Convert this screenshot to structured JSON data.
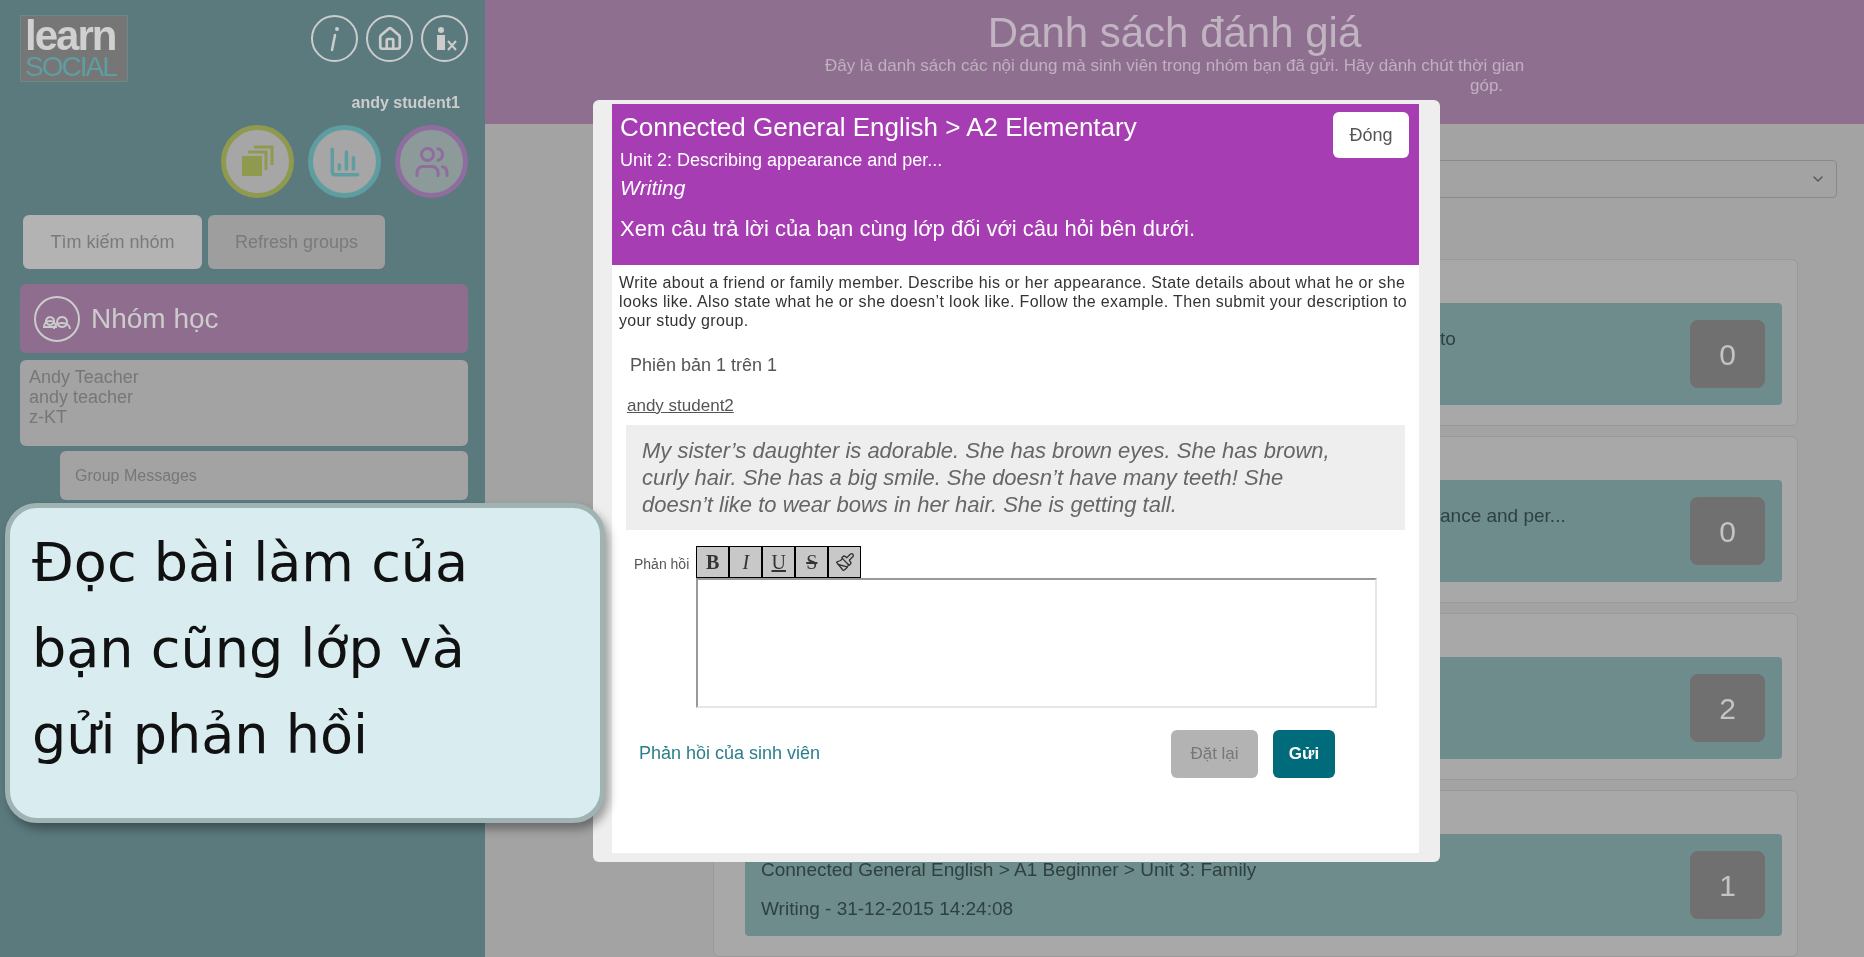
{
  "sidebar": {
    "logo": {
      "line_1": "learn",
      "line_2": "SOCIAL"
    },
    "username": "andy student1",
    "buttons": [
      {
        "label": "Tìm kiếm nhóm",
        "kind": "light"
      },
      {
        "label": "Refresh groups",
        "kind": "dark"
      }
    ],
    "section_title": "Nhóm học",
    "group_lines": [
      "Andy Teacher",
      "andy teacher",
      "z-KT"
    ],
    "group_messages": "Group Messages"
  },
  "header": {
    "title": "Danh sách đánh giá",
    "subtitle_line_1": "Đây là danh sách các nội dung mà sinh viên trong nhóm bạn đã gửi. Hãy dành chút thời gian",
    "subtitle_line_2": "góp."
  },
  "cards": [
    {
      "kind": "covered",
      "line_1": "to",
      "count": "0"
    },
    {
      "kind": "covered",
      "line_1": "ance and per...",
      "count": "0"
    },
    {
      "kind": "covered",
      "count": "2"
    },
    {
      "kind": "full",
      "line_1": "Connected General English > A1 Beginner > Unit 3: Family",
      "line_2": "Writing - 31-12-2015 14:24:08",
      "count": "1"
    }
  ],
  "modal": {
    "course": "Connected General English > A2 Elementary",
    "unit": "Unit 2: Describing appearance and per...",
    "activity": "Writing",
    "heading": "Xem câu trả lời của bạn cùng lớp đối với câu hỏi bên dưới.",
    "close": "Đóng",
    "prompt": "Write about a friend or family member. Describe his or her appearance. State details about what he or she looks like. Also state what he or she doesn’t look like. Follow the example. Then submit your description to your study group.",
    "version": "Phiên bản 1 trên 1",
    "author": "andy student2",
    "answer": "My sister’s daughter is adorable. She has brown eyes. She has brown, curly hair. She has a big smile. She doesn’t have many teeth! She doesn’t like to wear bows in her hair. She is getting tall.",
    "feedback_label": "Phản hồi",
    "toolbar": [
      {
        "kind": "bold",
        "label": "B"
      },
      {
        "kind": "italic",
        "label": "I"
      },
      {
        "kind": "underline",
        "label": "U"
      },
      {
        "kind": "strike",
        "label": "S"
      },
      {
        "kind": "brush"
      }
    ],
    "link": "Phản hồi của sinh viên",
    "reset": "Đặt lại",
    "submit": "Gửi"
  },
  "callout": "Đọc bài làm của bạn cũng lớp và gửi phản hồi"
}
